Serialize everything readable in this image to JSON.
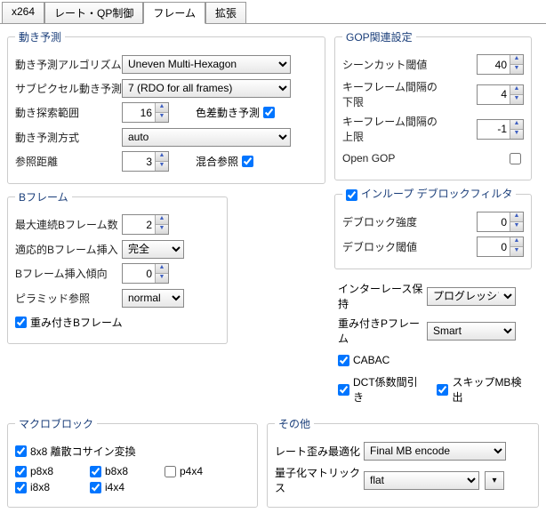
{
  "tabs": {
    "t0": "x264",
    "t1": "レート・QP制御",
    "t2": "フレーム",
    "t3": "拡張"
  },
  "motion": {
    "legend": "動き予測",
    "algo_label": "動き予測アルゴリズム",
    "algo_value": "Uneven Multi-Hexagon",
    "subpel_label": "サブピクセル動き予測",
    "subpel_value": "7 (RDO for all frames)",
    "range_label": "動き探索範囲",
    "range_value": "16",
    "chroma_label": "色差動き予測",
    "method_label": "動き予測方式",
    "method_value": "auto",
    "ref_label": "参照距離",
    "ref_value": "3",
    "mixref_label": "混合参照"
  },
  "bframe": {
    "legend": "Bフレーム",
    "max_label": "最大連続Bフレーム数",
    "max_value": "2",
    "adapt_label": "適応的Bフレーム挿入",
    "adapt_value": "完全",
    "bias_label": "Bフレーム挿入傾向",
    "bias_value": "0",
    "pyramid_label": "ピラミッド参照",
    "pyramid_value": "normal",
    "wb_label": "重み付きBフレーム"
  },
  "gop": {
    "legend": "GOP関連設定",
    "scenecut_label": "シーンカット閾値",
    "scenecut_value": "40",
    "keymin_label": "キーフレーム間隔の下限",
    "keymin_value": "4",
    "keymax_label": "キーフレーム間隔の上限",
    "keymax_value": "-1",
    "opengop_label": "Open GOP"
  },
  "deblock": {
    "legend": "インループ デブロックフィルタ",
    "strength_label": "デブロック強度",
    "strength_value": "0",
    "thresh_label": "デブロック閾値",
    "thresh_value": "0"
  },
  "misc": {
    "interlace_label": "インターレース保持",
    "interlace_value": "プログレッシブ",
    "wp_label": "重み付きPフレーム",
    "wp_value": "Smart",
    "cabac_label": "CABAC",
    "dct_label": "DCT係数間引き",
    "skip_label": "スキップMB検出"
  },
  "macro": {
    "legend": "マクロブロック",
    "dct8_label": "8x8 離散コサイン変換",
    "p8": "p8x8",
    "b8": "b8x8",
    "p4": "p4x4",
    "i8": "i8x8",
    "i4": "i4x4"
  },
  "other": {
    "legend": "その他",
    "rdo_label": "レート歪み最適化",
    "rdo_value": "Final MB encode",
    "cqm_label": "量子化マトリックス",
    "cqm_value": "flat"
  }
}
